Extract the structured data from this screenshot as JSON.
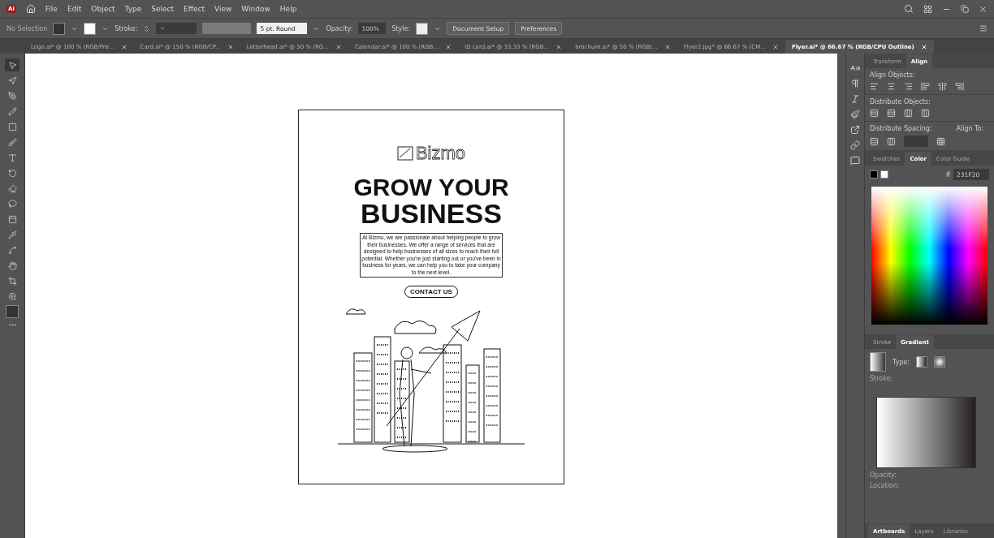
{
  "menu_bar": {
    "app_badge": "Ai",
    "menus": [
      "File",
      "Edit",
      "Object",
      "Type",
      "Select",
      "Effect",
      "View",
      "Window",
      "Help"
    ]
  },
  "control_bar": {
    "selection": "No Selection",
    "stroke_label": "Stroke:",
    "brush": "5 pt. Round",
    "opacity_label": "Opacity:",
    "opacity": "100%",
    "style_label": "Style:",
    "buttons": [
      "Document Setup",
      "Preferences"
    ]
  },
  "document_tabs": [
    {
      "label": "Logo.ai* @ 100 % (RGB/Pre...",
      "selected": false
    },
    {
      "label": "Card.ai* @ 150 % (RGB/CP...",
      "selected": false
    },
    {
      "label": "Letterhead.ai* @ 50 % (RG...",
      "selected": false
    },
    {
      "label": "Calendar.ai* @ 100 % (RGB...",
      "selected": false
    },
    {
      "label": "ID card.ai* @ 33.33 % (RGB...",
      "selected": false
    },
    {
      "label": "brochure.ai* @ 50 % (RGB/...",
      "selected": false
    },
    {
      "label": "Flyer2.jpg* @ 66.67 % (CM...",
      "selected": false
    },
    {
      "label": "Flyer.ai* @ 66.67 % (RGB/CPU Outline)",
      "selected": true
    }
  ],
  "tools": [
    {
      "kind": "selection",
      "selected": true
    },
    {
      "kind": "direct",
      "selected": false
    },
    {
      "kind": "pen",
      "selected": false
    },
    {
      "kind": "pencil",
      "selected": false
    },
    {
      "kind": "rectangle",
      "selected": false
    },
    {
      "kind": "brush",
      "selected": false
    },
    {
      "kind": "type",
      "selected": false
    },
    {
      "kind": "rotate",
      "selected": false
    },
    {
      "kind": "eraser",
      "selected": false
    },
    {
      "kind": "lasso",
      "selected": false
    },
    {
      "kind": "gradient",
      "selected": false
    },
    {
      "kind": "eyedropper",
      "selected": false
    },
    {
      "kind": "blend",
      "selected": false
    },
    {
      "kind": "hand",
      "selected": false
    },
    {
      "kind": "crop",
      "selected": false
    },
    {
      "kind": "zoom",
      "selected": false
    }
  ],
  "artboard": {
    "logo": "Bizmo",
    "headline": [
      "GROW YOUR",
      "BUSINESS"
    ],
    "paragraph": "At Bizmo, we are passionate about helping people to grow their businesses. We offer a range of services that are designed to help businesses of all sizes to reach their full potential. Whether you're just starting out or you've been in business for years, we can help you to take your company to the next level.",
    "button": "CONTACT US"
  },
  "align_panel": {
    "tabs": [
      {
        "label": "Transform",
        "selected": false
      },
      {
        "label": "Align",
        "selected": true
      }
    ],
    "sections": [
      "Align Objects:",
      "Distribute Objects:",
      "Distribute Spacing:"
    ],
    "align_to": "Align To:"
  },
  "color_panel": {
    "tabs": [
      {
        "label": "Swatches",
        "selected": false
      },
      {
        "label": "Color",
        "selected": true
      },
      {
        "label": "Color Guide",
        "selected": false
      }
    ],
    "hex_sign": "#",
    "hex": "231F20"
  },
  "gradient_panel": {
    "tabs": [
      {
        "label": "Stroke",
        "selected": false
      },
      {
        "label": "Gradient",
        "selected": true
      }
    ],
    "type_label": "Type:",
    "stroke_label": "Stroke:",
    "opacity_label": "Opacity:",
    "location_label": "Location:"
  },
  "bottom_tabs": [
    {
      "label": "Artboards",
      "selected": true
    },
    {
      "label": "Layers",
      "selected": false
    },
    {
      "label": "Libraries",
      "selected": false
    }
  ]
}
